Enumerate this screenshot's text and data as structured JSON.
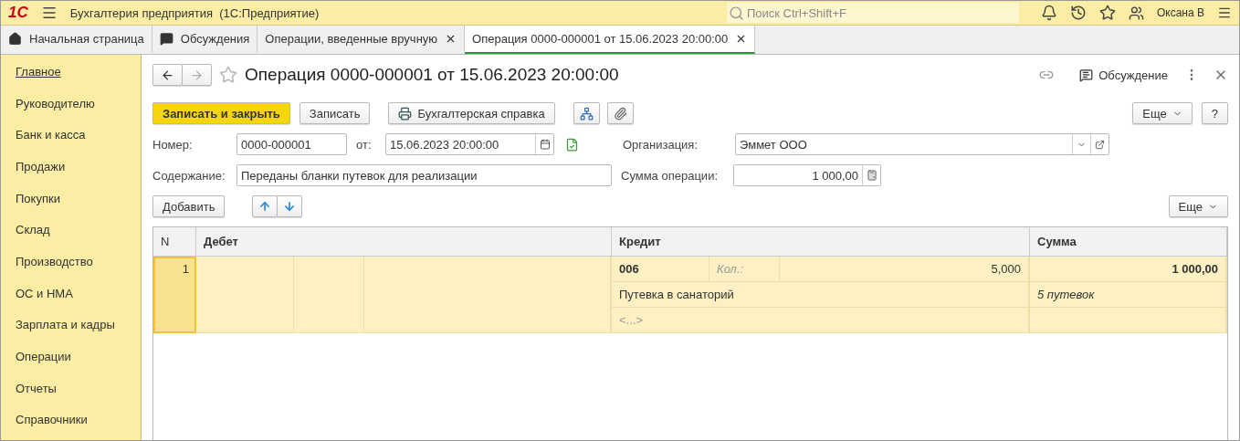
{
  "header": {
    "logo": "1С",
    "app_title": "Бухгалтерия предприятия  (1С:Предприятие)",
    "search_placeholder": "Поиск Ctrl+Shift+F",
    "user": "Оксана В"
  },
  "tabs": [
    {
      "label": "Начальная страница",
      "closable": false,
      "selected": false
    },
    {
      "label": "Обсуждения",
      "closable": false,
      "selected": false
    },
    {
      "label": "Операции, введенные вручную",
      "closable": true,
      "selected": false
    },
    {
      "label": "Операция 0000-000001 от 15.06.2023 20:00:00",
      "closable": true,
      "selected": true
    }
  ],
  "sidebar": {
    "items": [
      {
        "label": "Главное",
        "selected": true
      },
      {
        "label": "Руководителю",
        "selected": false
      },
      {
        "label": "Банк и касса",
        "selected": false
      },
      {
        "label": "Продажи",
        "selected": false
      },
      {
        "label": "Покупки",
        "selected": false
      },
      {
        "label": "Склад",
        "selected": false
      },
      {
        "label": "Производство",
        "selected": false
      },
      {
        "label": "ОС и НМА",
        "selected": false
      },
      {
        "label": "Зарплата и кадры",
        "selected": false
      },
      {
        "label": "Операции",
        "selected": false
      },
      {
        "label": "Отчеты",
        "selected": false
      },
      {
        "label": "Справочники",
        "selected": false
      }
    ]
  },
  "document": {
    "title": "Операция 0000-000001 от 15.06.2023 20:00:00",
    "favorite": false,
    "discussion": "Обсуждение",
    "toolbar": {
      "save_close": "Записать и закрыть",
      "save": "Записать",
      "report": "Бухгалтерская справка",
      "more": "Еще",
      "help": "?"
    },
    "fields": {
      "number_label": "Номер:",
      "number": "0000-000001",
      "date_label": "от:",
      "date": "15.06.2023 20:00:00",
      "org_label": "Организация:",
      "org": "Эммет ООО",
      "content_label": "Содержание:",
      "content": "Переданы бланки путевок для реализации",
      "sum_label": "Сумма операции:",
      "sum": "1 000,00"
    },
    "table_toolbar": {
      "add": "Добавить",
      "more": "Еще"
    },
    "table": {
      "columns": [
        "N",
        "Дебет",
        "Кредит",
        "Сумма"
      ],
      "rows": [
        {
          "n": "1",
          "selected": true,
          "credit_account": "006",
          "qty_label": "Кол.:",
          "qty": "5,000",
          "credit_subconto": "Путевка в санаторий",
          "credit_empty": "<...>",
          "amount": "1 000,00",
          "amount_note": "5 путевок"
        }
      ]
    }
  }
}
